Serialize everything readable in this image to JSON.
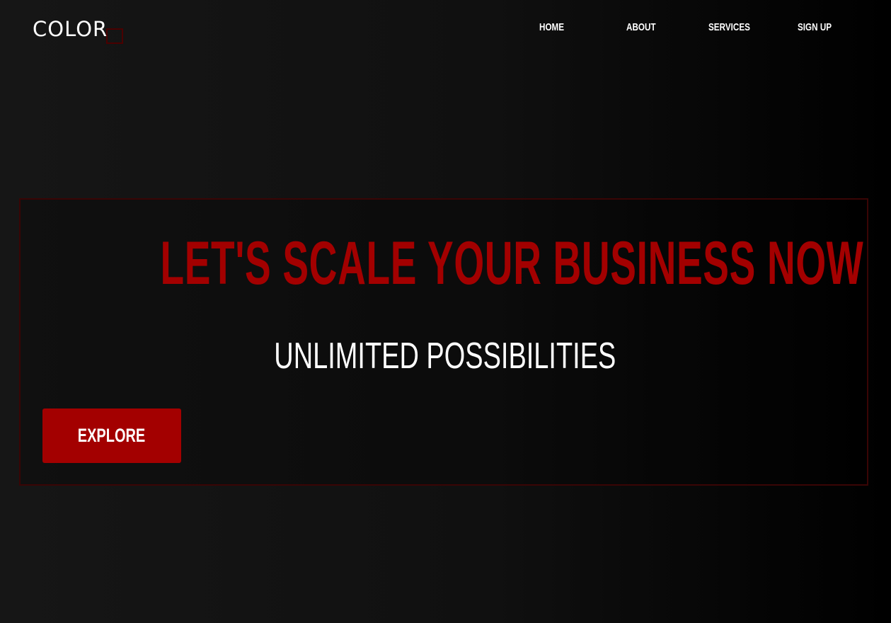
{
  "brand": {
    "logo_text": "COLOR"
  },
  "nav": {
    "items": [
      {
        "label": "HOME"
      },
      {
        "label": "ABOUT"
      },
      {
        "label": "SERVICES"
      },
      {
        "label": "SIGN UP"
      }
    ]
  },
  "hero": {
    "headline": "LET'S SCALE YOUR BUSINESS NOW",
    "subheadline": "UNLIMITED POSSIBILITIES",
    "cta_label": "EXPLORE"
  },
  "colors": {
    "accent": "#a30000",
    "background": "#111111",
    "text": "#ffffff",
    "frame_border": "#3a0505"
  }
}
